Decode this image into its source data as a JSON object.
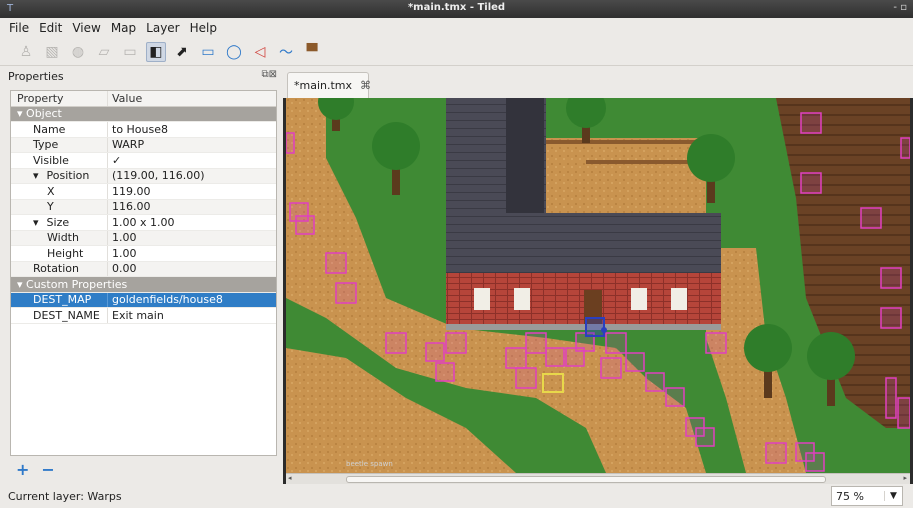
{
  "window": {
    "title": "*main.tmx - Tiled",
    "app_icon": "tiled-app-icon",
    "controls": "- ▫"
  },
  "menu": [
    "File",
    "Edit",
    "View",
    "Map",
    "Layer",
    "Help"
  ],
  "toolbar": {
    "tools": [
      {
        "name": "stamp-brush-icon",
        "glyph": "♙",
        "state": "dim"
      },
      {
        "name": "terrain-brush-icon",
        "glyph": "▧",
        "state": "dim"
      },
      {
        "name": "bucket-fill-icon",
        "glyph": "◍",
        "state": "dim"
      },
      {
        "name": "eraser-icon",
        "glyph": "▱",
        "state": "dim"
      },
      {
        "name": "rect-select-icon",
        "glyph": "▭",
        "state": "dim"
      },
      {
        "name": "select-objects-icon",
        "glyph": "◧",
        "state": "active"
      },
      {
        "name": "edit-polygons-icon",
        "glyph": "⬈",
        "state": "normal"
      },
      {
        "name": "insert-rectangle-icon",
        "glyph": "▭",
        "state": "blue"
      },
      {
        "name": "insert-ellipse-icon",
        "glyph": "◯",
        "state": "blue"
      },
      {
        "name": "insert-polygon-icon",
        "glyph": "◁",
        "state": "red"
      },
      {
        "name": "insert-polyline-icon",
        "glyph": "〜",
        "state": "blue"
      },
      {
        "name": "insert-tile-icon",
        "glyph": "▀",
        "state": "brown"
      }
    ]
  },
  "properties_panel": {
    "title": "Properties",
    "header": {
      "col1": "Property",
      "col2": "Value"
    },
    "rows": [
      {
        "type": "group",
        "label": "Object"
      },
      {
        "type": "prop",
        "indent": 1,
        "key": "Name",
        "value": "to House8"
      },
      {
        "type": "prop",
        "indent": 1,
        "key": "Type",
        "value": "WARP"
      },
      {
        "type": "prop",
        "indent": 1,
        "key": "Visible",
        "value": "✓"
      },
      {
        "type": "prop",
        "indent": 1,
        "expand": "▾",
        "key": "Position",
        "value": "(119.00, 116.00)"
      },
      {
        "type": "prop",
        "indent": 2,
        "key": "X",
        "value": "119.00"
      },
      {
        "type": "prop",
        "indent": 2,
        "key": "Y",
        "value": "116.00"
      },
      {
        "type": "prop",
        "indent": 1,
        "expand": "▾",
        "key": "Size",
        "value": "1.00 x 1.00"
      },
      {
        "type": "prop",
        "indent": 2,
        "key": "Width",
        "value": "1.00"
      },
      {
        "type": "prop",
        "indent": 2,
        "key": "Height",
        "value": "1.00"
      },
      {
        "type": "prop",
        "indent": 1,
        "key": "Rotation",
        "value": "0.00"
      },
      {
        "type": "group",
        "label": "Custom Properties"
      },
      {
        "type": "prop",
        "indent": 1,
        "key": "DEST_MAP",
        "value": "goldenfields/house8",
        "selected": true
      },
      {
        "type": "prop",
        "indent": 1,
        "key": "DEST_NAME",
        "value": "Exit main"
      }
    ],
    "add_label": "+",
    "remove_label": "−"
  },
  "tabs": [
    {
      "label": "*main.tmx",
      "close": "⌘"
    }
  ],
  "map": {
    "object_label": "beetle spawn",
    "object_color": "#e040c0",
    "selected_color": "#2a3fbf",
    "highlight_color": "#e8d84a"
  },
  "status": {
    "current_layer": "Current layer: Warps",
    "zoom": "75 %"
  }
}
